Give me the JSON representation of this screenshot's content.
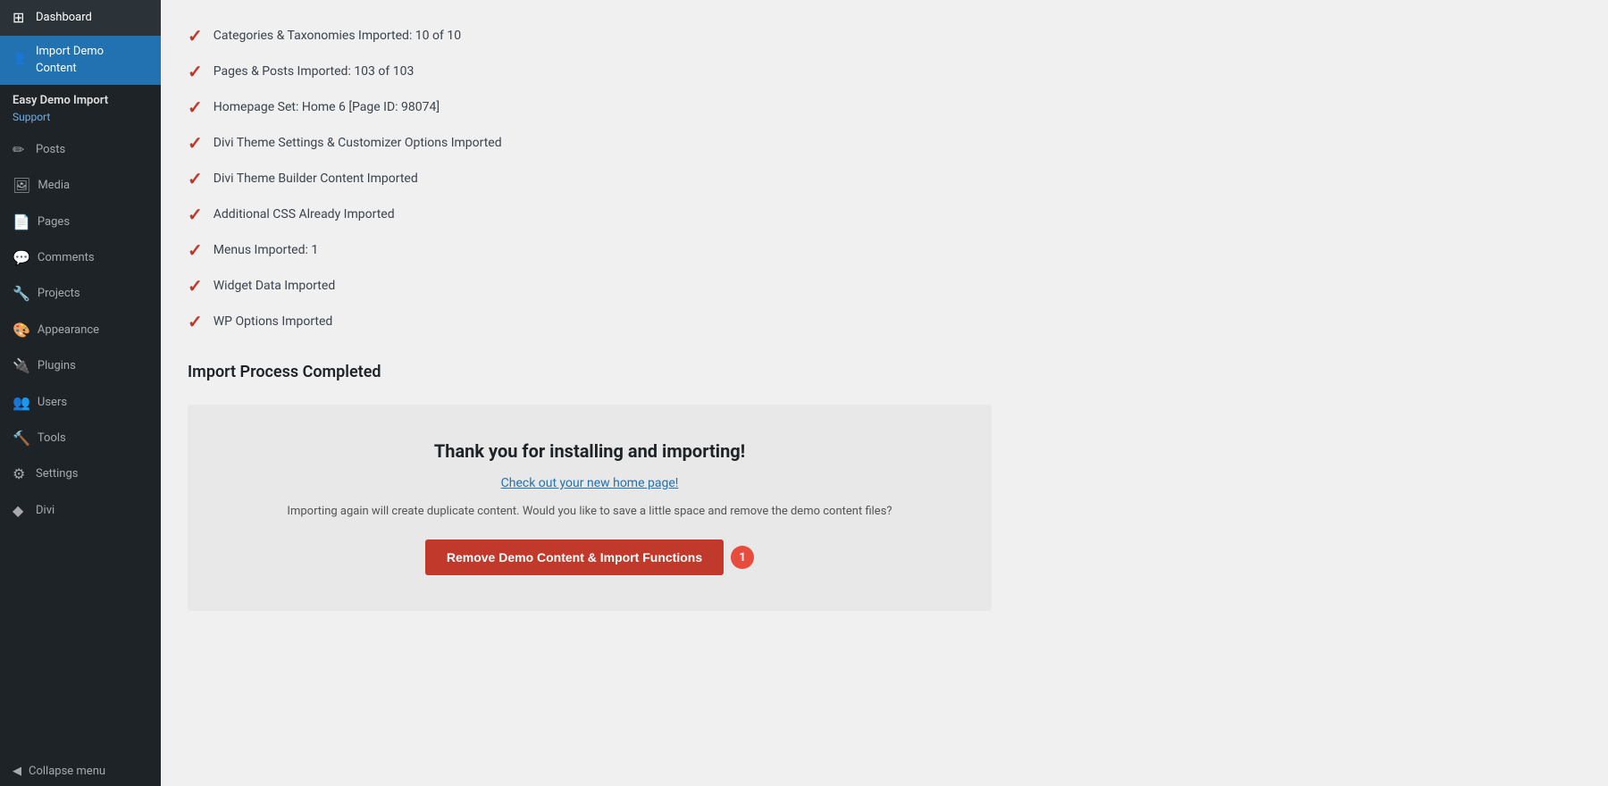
{
  "sidebar": {
    "logo_label": "Dashboard",
    "active_item": "Import Demo Content",
    "active_item_line2": "Content",
    "plugin_name": "Easy Demo Import",
    "plugin_support": "Support",
    "items": [
      {
        "id": "dashboard",
        "label": "Dashboard",
        "icon": "⊞"
      },
      {
        "id": "import-demo-content",
        "label": "Import Demo Content",
        "icon": "👤"
      },
      {
        "id": "posts",
        "label": "Posts",
        "icon": "✏️"
      },
      {
        "id": "media",
        "label": "Media",
        "icon": "🖼"
      },
      {
        "id": "pages",
        "label": "Pages",
        "icon": "📄"
      },
      {
        "id": "comments",
        "label": "Comments",
        "icon": "💬"
      },
      {
        "id": "projects",
        "label": "Projects",
        "icon": "🔧"
      },
      {
        "id": "appearance",
        "label": "Appearance",
        "icon": "🎨"
      },
      {
        "id": "plugins",
        "label": "Plugins",
        "icon": "🔌"
      },
      {
        "id": "users",
        "label": "Users",
        "icon": "👥"
      },
      {
        "id": "tools",
        "label": "Tools",
        "icon": "🔨"
      },
      {
        "id": "settings",
        "label": "Settings",
        "icon": "⚙️"
      },
      {
        "id": "divi",
        "label": "Divi",
        "icon": "🔷"
      }
    ],
    "collapse_label": "Collapse menu"
  },
  "import_items": [
    "Categories & Taxonomies Imported: 10 of 10",
    "Pages & Posts Imported: 103 of 103",
    "Homepage Set: Home 6 [Page ID: 98074]",
    "Divi Theme Settings & Customizer Options Imported",
    "Divi Theme Builder Content Imported",
    "Additional CSS Already Imported",
    "Menus Imported: 1",
    "Widget Data Imported",
    "WP Options Imported"
  ],
  "completed_title": "Import Process Completed",
  "thank_you_box": {
    "title": "Thank you for installing and importing!",
    "home_link": "Check out your new home page!",
    "warning": "Importing again will create duplicate content. Would you like to save a little space and remove the demo content files?",
    "remove_button": "Remove Demo Content & Import Functions",
    "badge_count": "1"
  }
}
